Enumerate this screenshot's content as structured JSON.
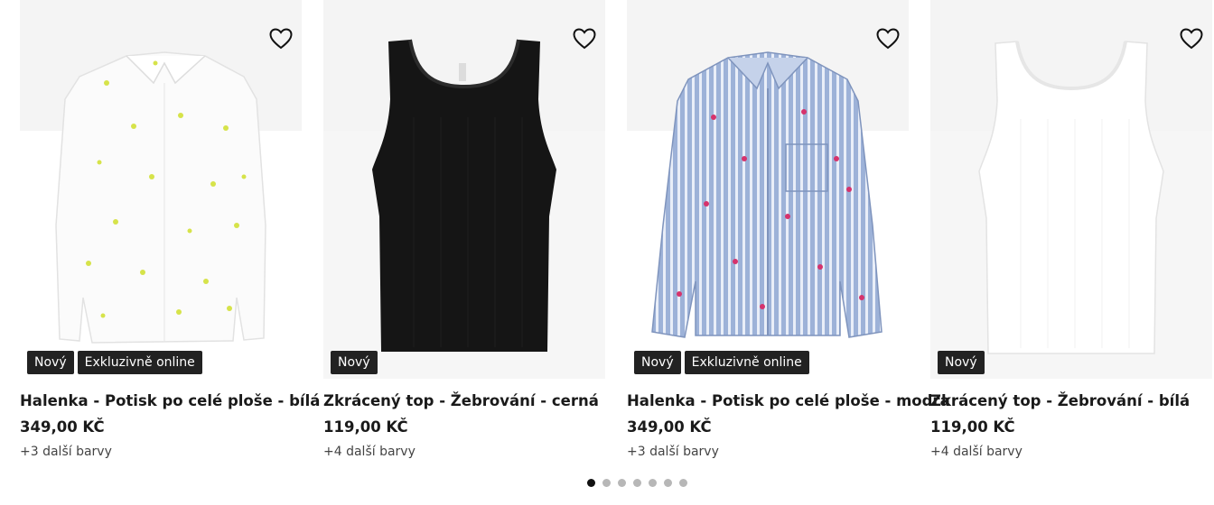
{
  "products": [
    {
      "title": "Halenka - Potisk po celé ploše - bílá",
      "price": "349,00 KČ",
      "colors": "+3 další barvy",
      "badges": [
        "Nový",
        "Exkluzivně online"
      ],
      "garment": "white shirt with yellow lemon print",
      "favorite_icon": "heart-outline-icon"
    },
    {
      "title": "Zkrácený top - Žebrování - cerná",
      "price": "119,00 KČ",
      "colors": "+4 další barvy",
      "badges": [
        "Nový"
      ],
      "garment": "black ribbed tank top",
      "favorite_icon": "heart-outline-icon"
    },
    {
      "title": "Halenka - Potisk po celé ploše - modra",
      "price": "349,00 KČ",
      "colors": "+3 další barvy",
      "badges": [
        "Nový",
        "Exkluzivně online"
      ],
      "garment": "blue striped shirt with pink print",
      "favorite_icon": "heart-outline-icon"
    },
    {
      "title": "Zkrácený top - Žebrování - bílá",
      "price": "119,00 KČ",
      "colors": "+4 další barvy",
      "badges": [
        "Nový"
      ],
      "garment": "white ribbed tank top",
      "favorite_icon": "heart-outline-icon"
    }
  ],
  "pagination": {
    "total_pages": 7,
    "current_page": 1
  },
  "colors": {
    "badge_bg": "#222222",
    "image_bg": "#f5f5f5",
    "dot_active": "#111111",
    "dot_inactive": "#b7b7b7"
  }
}
